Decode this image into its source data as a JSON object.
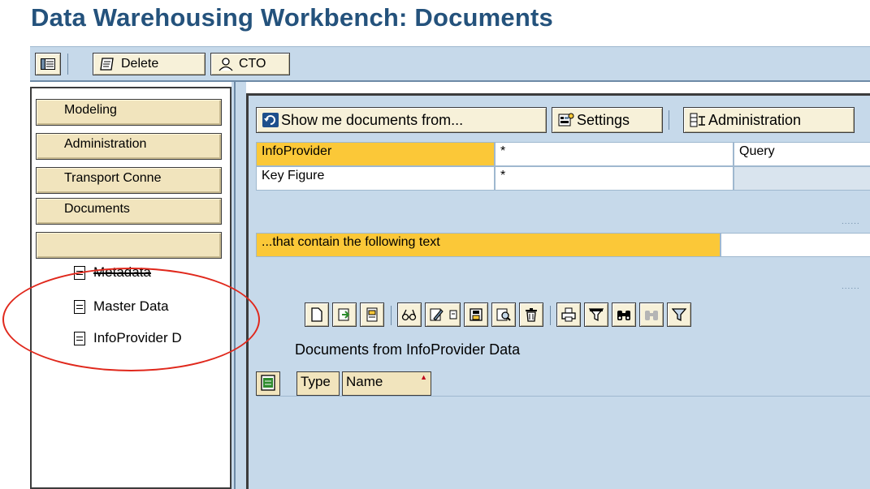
{
  "title": "Data Warehousing Workbench: Documents",
  "toolbar": {
    "delete_label": "Delete",
    "cto_label": "CTO"
  },
  "left": {
    "buttons": [
      "Modeling",
      "Administration",
      "Transport Conne",
      "Documents"
    ],
    "input_value": "",
    "items": [
      "Metadata",
      "Master Data",
      "InfoProvider D"
    ]
  },
  "right": {
    "buttons": {
      "show": "Show me documents from...",
      "settings": "Settings",
      "admin": "Administration"
    },
    "grid": {
      "row1_label": "InfoProvider",
      "row1_value": "*",
      "row1_col3": "Query",
      "row2_label": "Key Figure",
      "row2_value": "*"
    },
    "contain_label": "...that contain the following text",
    "doc_label": "Documents from InfoProvider Data",
    "columns": [
      "Type",
      "Name"
    ]
  },
  "annotation_color": "#e0281c"
}
